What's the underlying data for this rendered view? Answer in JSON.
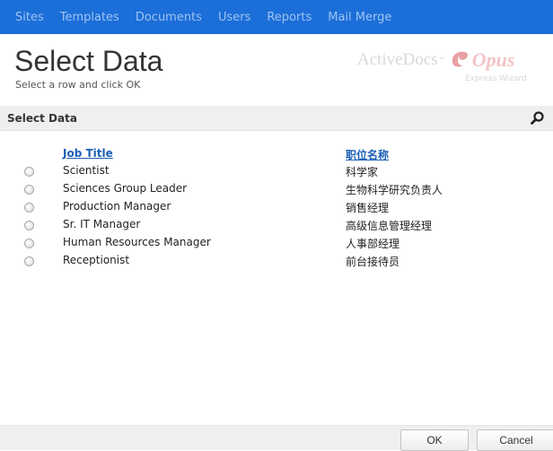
{
  "nav": {
    "items": [
      "Sites",
      "Templates",
      "Documents",
      "Users",
      "Reports",
      "Mail Merge"
    ]
  },
  "header": {
    "title": "Select Data",
    "subtitle": "Select a row and click OK"
  },
  "brand": {
    "name": "ActiveDocs",
    "tm": "™",
    "product": "Opus",
    "tagline": "Express Wizard",
    "logo_color": "#e8a0a4"
  },
  "section": {
    "title": "Select Data",
    "search_icon": "search-icon"
  },
  "grid": {
    "columns": [
      "Job Title",
      "职位名称"
    ],
    "rows": [
      [
        "Scientist",
        "科学家"
      ],
      [
        "Sciences Group Leader",
        "生物科学研究负责人"
      ],
      [
        "Production Manager",
        "销售经理"
      ],
      [
        "Sr. IT Manager",
        "高级信息管理经理"
      ],
      [
        "Human Resources Manager",
        "人事部经理"
      ],
      [
        "Receptionist",
        "前台接待员"
      ]
    ]
  },
  "footer": {
    "ok_label": "OK",
    "cancel_label": "Cancel"
  },
  "colors": {
    "nav_bg": "#1c6ed8",
    "nav_text": "#9cc3f2",
    "link": "#1a5fb4",
    "bar_bg": "#efefef"
  }
}
